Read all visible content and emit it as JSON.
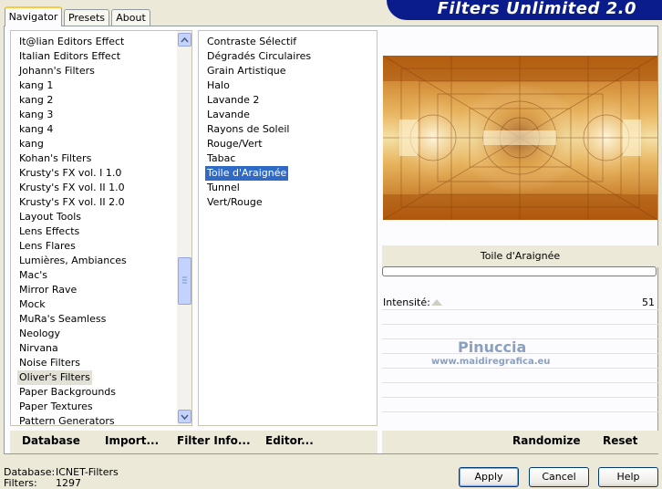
{
  "banner": {
    "title": "Filters Unlimited 2.0"
  },
  "tabs": [
    {
      "label": "Navigator",
      "active": true
    },
    {
      "label": "Presets",
      "active": false
    },
    {
      "label": "About",
      "active": false
    }
  ],
  "categories": {
    "selected": "Oliver's Filters",
    "items": [
      "It@lian Editors Effect",
      "Italian Editors Effect",
      "Johann's Filters",
      "kang 1",
      "kang 2",
      "kang 3",
      "kang 4",
      "kang",
      "Kohan's Filters",
      "Krusty's FX vol. I 1.0",
      "Krusty's FX vol. II 1.0",
      "Krusty's FX vol. II 2.0",
      "Layout Tools",
      "Lens Effects",
      "Lens Flares",
      "Lumières, Ambiances",
      "Mac's",
      "Mirror Rave",
      "Mock",
      "MuRa's Seamless",
      "Neology",
      "Nirvana",
      "Noise Filters",
      "Oliver's Filters",
      "Paper Backgrounds",
      "Paper Textures",
      "Pattern Generators"
    ]
  },
  "filters": {
    "selected": "Toile d'Araignée",
    "items": [
      "Contraste Sélectif",
      "Dégradés Circulaires",
      "Grain Artistique",
      "Halo",
      "Lavande 2",
      "Lavande",
      "Rayons de Soleil",
      "Rouge/Vert",
      "Tabac",
      "Toile d'Araignée",
      "Tunnel",
      "Vert/Rouge"
    ]
  },
  "preview": {
    "filter_name": "Toile d'Araignée"
  },
  "params": [
    {
      "label": "Intensité:",
      "value": "51"
    }
  ],
  "watermark": {
    "line1": "Pinuccia",
    "line2": "www.maidiregrafica.eu"
  },
  "bottom_buttons": {
    "database": "Database",
    "import": "Import...",
    "filter_info": "Filter Info...",
    "editor": "Editor...",
    "randomize": "Randomize",
    "reset": "Reset"
  },
  "status": {
    "database_label": "Database:",
    "database_value": "ICNET-Filters",
    "filters_label": "Filters:",
    "filters_value": "1297"
  },
  "dialog_buttons": {
    "apply": "Apply",
    "cancel": "Cancel",
    "help": "Help"
  },
  "colors": {
    "banner": "#0a1c8c",
    "selection": "#316ac5",
    "tab_highlight": "#ffc83c"
  }
}
